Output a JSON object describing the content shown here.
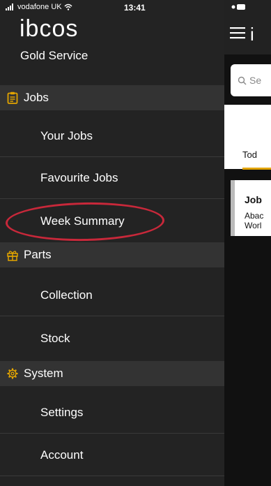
{
  "status_bar": {
    "carrier": "vodafone UK",
    "time": "13:41"
  },
  "app": {
    "logo": "ibcos",
    "subtitle": "Gold Service",
    "brand_partial": "i"
  },
  "menu": {
    "sections": [
      {
        "title": "Jobs",
        "icon": "clipboard-icon",
        "items": [
          "Your Jobs",
          "Favourite Jobs",
          "Week Summary"
        ]
      },
      {
        "title": "Parts",
        "icon": "gift-box-icon",
        "items": [
          "Collection",
          "Stock"
        ]
      },
      {
        "title": "System",
        "icon": "gear-icon",
        "items": [
          "Settings",
          "Account"
        ]
      }
    ]
  },
  "main": {
    "search_placeholder": "Se",
    "tab_label": "Tod",
    "card": {
      "title": "Job",
      "line1": "Abac",
      "line2": "Worl"
    }
  },
  "colors": {
    "accent": "#E2A400",
    "highlight_ring": "#C8283A",
    "sidebar_bg": "#232323",
    "section_bg": "#333333"
  }
}
